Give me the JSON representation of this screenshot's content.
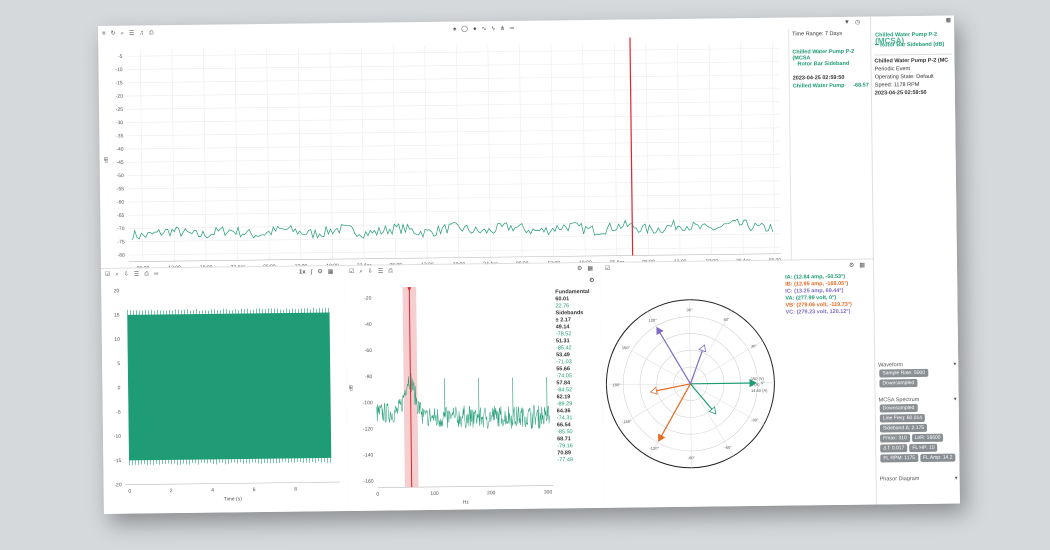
{
  "colors": {
    "accent_green": "#1f9c76",
    "cursor_red": "#e0262b",
    "shade_red": "#f3c3c3",
    "grid": "#ececec",
    "ia": "#1f9c76",
    "ib": "#e46b25",
    "ic": "#7f6bc4",
    "va": "#1f9c76",
    "vb": "#e46b25",
    "vc": "#7f6bc4"
  },
  "top_toolbar": {
    "left_icons": [
      "menu-icon",
      "refresh-icon",
      "zoom-icon",
      "list-icon",
      "bell-icon",
      "print-icon"
    ],
    "center_icons": [
      "bell-icon",
      "comment-icon",
      "circle-icon",
      "rss-icon",
      "bolt-icon",
      "fork-icon",
      "equals-icon"
    ],
    "right_icons": [
      "filter-icon",
      "clock-icon"
    ]
  },
  "trend": {
    "ylabel": "dB",
    "y_ticks": [
      "-5",
      "-10",
      "-15",
      "-20",
      "-25",
      "-30",
      "-35",
      "-40",
      "-45",
      "-50",
      "-55",
      "-60",
      "-65",
      "-70",
      "-75",
      "-80"
    ],
    "x_ticks": [
      "06:00",
      "12:00",
      "18:00",
      "22 Apr",
      "06:00",
      "12:00",
      "18:00",
      "23 Apr",
      "06:00",
      "12:00",
      "18:00",
      "24 Apr",
      "06:00",
      "12:00",
      "18:00",
      "25 Apr",
      "06:00",
      "12:00",
      "18:00",
      "26 Apr",
      "06:00"
    ],
    "cursor_label": "25 Apr"
  },
  "info": {
    "time_range": "Time Range: 7 Days",
    "series_title": "Chilled Water Pump P-2 (MCSA",
    "series_sub": "Rotor Bar Sideband",
    "cursor_date": "2023-04-25 02:59:50",
    "cursor_series": "Chilled Water Pump",
    "cursor_value": "-68.57"
  },
  "right_panel": {
    "legend_title": "Chilled Water Pump P-2",
    "legend_overlap": "(MCSA)",
    "legend_sub": "Rotor Bar Sideband (dB)",
    "event_title": "Chilled Water Pump P-2 (MC",
    "event_type": "Periodic Event",
    "operating_state": "Operating State: Default",
    "speed": "Speed: 1178 RPM",
    "event_date": "2023-04-25 02:59:50",
    "waveform_title": "Waveform",
    "waveform_tags": [
      "Sample Rate: 5000",
      "Downsampled"
    ],
    "mcsa_title": "MCSA Spectrum",
    "mcsa_tags": [
      "Downsampled",
      "Line Freq: 60.014",
      "Sideband Δ: 2.175",
      "Fmax: 310",
      "LoR: 16600",
      "Δ f: 0.017",
      "FL HP: 10",
      "FL RPM: 1175",
      "FL Amp: 14.2"
    ],
    "phasor_title": "Phasor Diagram"
  },
  "waveform": {
    "toolbar_right": "1x",
    "y_ticks": [
      "20",
      "15",
      "10",
      "5",
      "0",
      "-5",
      "-10",
      "-15",
      "-20"
    ],
    "x_ticks": [
      "0",
      "2",
      "4",
      "6",
      "8"
    ],
    "xlabel": "Time (s)"
  },
  "spectrum": {
    "ylabel": "dB",
    "y_ticks": [
      "-20",
      "-40",
      "-60",
      "-80",
      "-100",
      "-120",
      "-140",
      "-160"
    ],
    "x_ticks": [
      "0",
      "100",
      "200",
      "300"
    ],
    "xlabel": "Hz",
    "list": [
      {
        "label": "Fundamental",
        "value": "60.01",
        "bold": true
      },
      {
        "label": "",
        "value": "22.76",
        "bold": false
      },
      {
        "label": "Sidebands",
        "value": "",
        "bold": true
      },
      {
        "label": "",
        "value": "± 2.17",
        "bold": true
      },
      {
        "label": "",
        "value": "49.14",
        "bold": true
      },
      {
        "label": "",
        "value": "-78.52",
        "bold": false
      },
      {
        "label": "",
        "value": "51.31",
        "bold": true
      },
      {
        "label": "",
        "value": "-85.42",
        "bold": false
      },
      {
        "label": "",
        "value": "53.49",
        "bold": true
      },
      {
        "label": "",
        "value": "-71.03",
        "bold": false
      },
      {
        "label": "",
        "value": "55.66",
        "bold": true
      },
      {
        "label": "",
        "value": "-74.05",
        "bold": false
      },
      {
        "label": "",
        "value": "57.84",
        "bold": true
      },
      {
        "label": "",
        "value": "-84.52",
        "bold": false
      },
      {
        "label": "",
        "value": "62.19",
        "bold": true
      },
      {
        "label": "",
        "value": "-89.29",
        "bold": false
      },
      {
        "label": "",
        "value": "64.36",
        "bold": true
      },
      {
        "label": "",
        "value": "-74.31",
        "bold": false
      },
      {
        "label": "",
        "value": "66.54",
        "bold": true
      },
      {
        "label": "",
        "value": "-85.50",
        "bold": false
      },
      {
        "label": "",
        "value": "68.71",
        "bold": true
      },
      {
        "label": "",
        "value": "-79.16",
        "bold": false
      },
      {
        "label": "",
        "value": "70.89",
        "bold": true
      },
      {
        "label": "",
        "value": "-77.49",
        "bold": false
      }
    ]
  },
  "phasor": {
    "legend": [
      {
        "text": "IA: (12.84 amp, -50.53°)",
        "color": "#1f9c76"
      },
      {
        "text": "IB: (12.95 amp, -169.05°)",
        "color": "#e46b25"
      },
      {
        "text": "IC: (13.25 amp, 69.44°)",
        "color": "#7f6bc4"
      },
      {
        "text": "VA: (277.99 volt, 0°)",
        "color": "#1f9c76"
      },
      {
        "text": "VB: (279.06 volt, -119.73°)",
        "color": "#e46b25"
      },
      {
        "text": "VC: (279.23 volt, 120.12°)",
        "color": "#7f6bc4"
      }
    ],
    "angle_labels": [
      "0°",
      "30°",
      "60°",
      "90°",
      "120°",
      "150°",
      "180°",
      "-150°",
      "-120°",
      "-90°",
      "-60°",
      "-30°"
    ],
    "radial_labels": [
      "150 (V)",
      "6 (A)",
      "14.60 (A)"
    ],
    "phasors": [
      {
        "name": "VA",
        "angle": 0,
        "mag": 1.0,
        "color": "#1f9c76",
        "hollow": false
      },
      {
        "name": "VB",
        "angle": -119.73,
        "mag": 1.0,
        "color": "#e46b25",
        "hollow": false
      },
      {
        "name": "VC",
        "angle": 120.12,
        "mag": 1.0,
        "color": "#7f6bc4",
        "hollow": false
      },
      {
        "name": "IA",
        "angle": -50.53,
        "mag": 0.6,
        "color": "#1f9c76",
        "hollow": true
      },
      {
        "name": "IB",
        "angle": -169.05,
        "mag": 0.62,
        "color": "#e46b25",
        "hollow": true
      },
      {
        "name": "IC",
        "angle": 69.44,
        "mag": 0.63,
        "color": "#7f6bc4",
        "hollow": true
      }
    ]
  }
}
